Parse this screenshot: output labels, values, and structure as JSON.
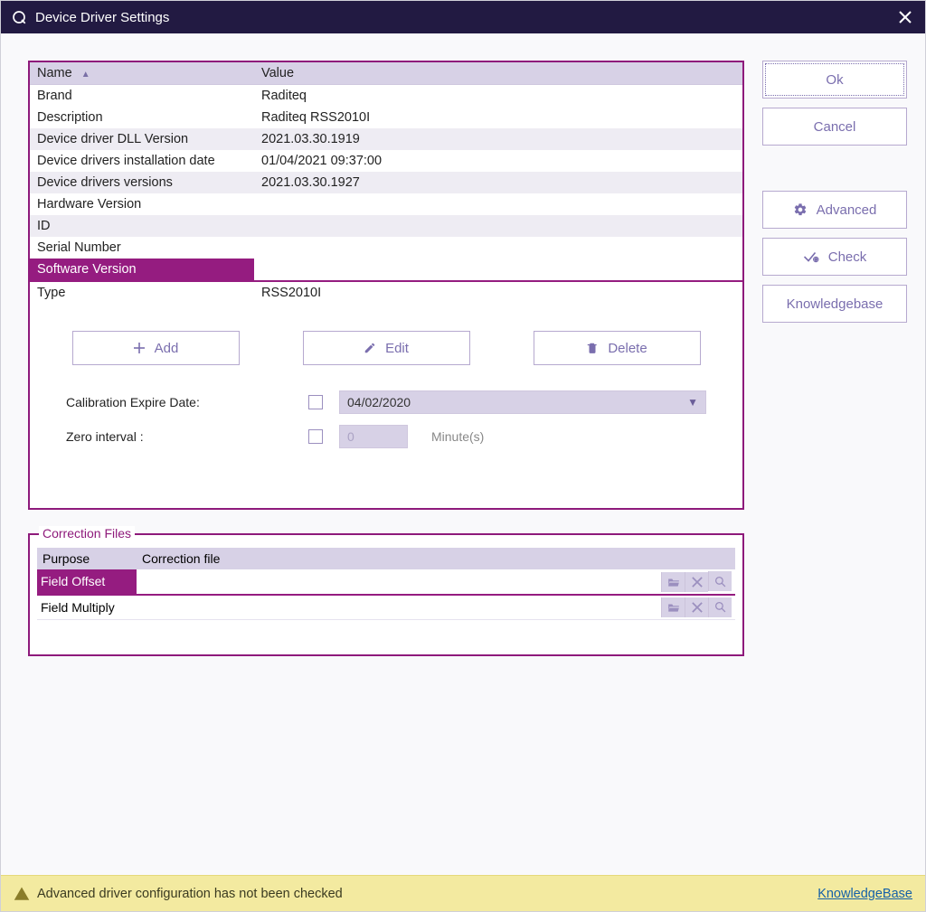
{
  "window": {
    "title": "Device Driver Settings"
  },
  "buttons": {
    "ok": "Ok",
    "cancel": "Cancel",
    "advanced": "Advanced",
    "check": "Check",
    "knowledgebase": "Knowledgebase",
    "add": "Add",
    "edit": "Edit",
    "delete": "Delete"
  },
  "table": {
    "headers": {
      "name": "Name",
      "value": "Value"
    },
    "rows": [
      {
        "name": "Brand",
        "value": "Raditeq",
        "alt": false
      },
      {
        "name": "Description",
        "value": "Raditeq RSS2010I",
        "alt": false
      },
      {
        "name": "Device driver DLL Version",
        "value": "2021.03.30.1919",
        "alt": true
      },
      {
        "name": "Device drivers installation date",
        "value": "01/04/2021 09:37:00",
        "alt": false
      },
      {
        "name": "Device drivers versions",
        "value": "2021.03.30.1927",
        "alt": true
      },
      {
        "name": "Hardware Version",
        "value": "",
        "alt": false
      },
      {
        "name": "ID",
        "value": "",
        "alt": true
      },
      {
        "name": "Serial Number",
        "value": "",
        "alt": false
      },
      {
        "name": "Software Version",
        "value": "",
        "alt": false,
        "selected": true
      },
      {
        "name": "Type",
        "value": "RSS2010I",
        "alt": false
      }
    ]
  },
  "fields": {
    "calib_label": "Calibration Expire Date:",
    "calib_value": "04/02/2020",
    "zero_label": "Zero interval :",
    "zero_value": "0",
    "zero_unit": "Minute(s)"
  },
  "correction": {
    "legend": "Correction Files",
    "headers": {
      "purpose": "Purpose",
      "file": "Correction file"
    },
    "rows": [
      {
        "purpose": "Field Offset",
        "file": "",
        "selected": true
      },
      {
        "purpose": "Field Multiply",
        "file": "",
        "selected": false
      }
    ]
  },
  "status": {
    "message": "Advanced driver configuration has not been checked",
    "link": "KnowledgeBase"
  }
}
